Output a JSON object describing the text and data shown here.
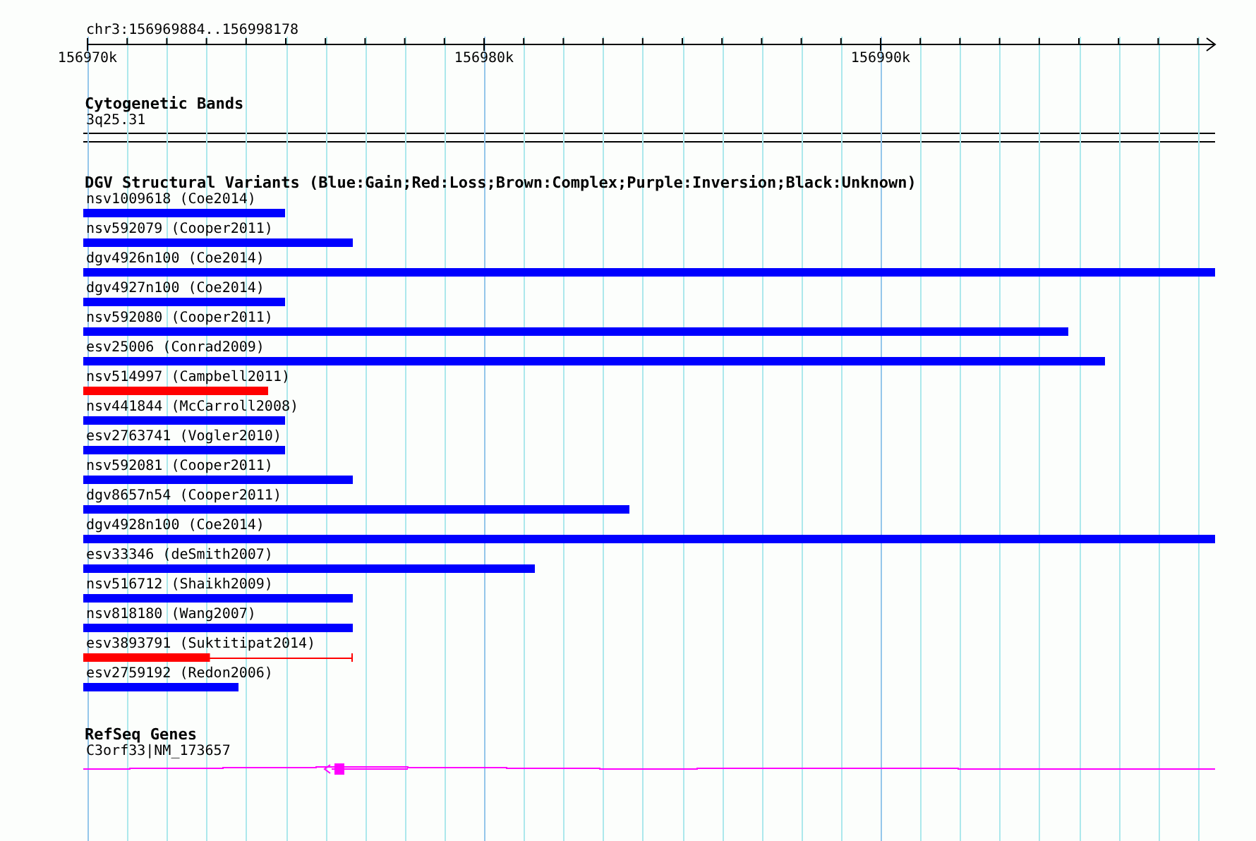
{
  "ruler": {
    "range": "chr3:156969884..156998178",
    "tick_labels": [
      "156970k",
      "156980k",
      "156990k"
    ]
  },
  "cytogenetic_bands": {
    "title": "Cytogenetic Bands",
    "band": "3q25.31"
  },
  "structural_variants": {
    "title": "DGV Structural Variants (Blue:Gain;Red:Loss;Brown:Complex;Purple:Inversion;Black:Unknown)",
    "items": [
      {
        "label": "nsv1009618 (Coe2014)",
        "color": "#0000ff",
        "level": 0.178,
        "kind": "solid"
      },
      {
        "label": "nsv592079 (Cooper2011)",
        "color": "#0000ff",
        "level": 0.238,
        "kind": "solid"
      },
      {
        "label": "dgv4926n100 (Coe2014)",
        "color": "#0000ff",
        "level": 1,
        "kind": "solid"
      },
      {
        "label": "dgv4927n100 (Coe2014)",
        "color": "#0000ff",
        "level": 0.178,
        "kind": "solid"
      },
      {
        "label": "nsv592080 (Cooper2011)",
        "color": "#0000ff",
        "level": 0.87,
        "kind": "solid"
      },
      {
        "label": "esv25006 (Conrad2009)",
        "color": "#0000ff",
        "level": 0.903,
        "kind": "solid"
      },
      {
        "label": "nsv514997 (Campbell2011)",
        "color": "#ff0000",
        "level": 0.163,
        "kind": "solid"
      },
      {
        "label": "nsv441844 (McCarroll2008)",
        "color": "#0000ff",
        "level": 0.178,
        "kind": "solid"
      },
      {
        "label": "esv2763741 (Vogler2010)",
        "color": "#0000ff",
        "level": 0.178,
        "kind": "solid"
      },
      {
        "label": "nsv592081 (Cooper2011)",
        "color": "#0000ff",
        "level": 0.238,
        "kind": "solid"
      },
      {
        "label": "dgv8657n54 (Cooper2011)",
        "color": "#0000ff",
        "level": 0.483,
        "kind": "solid"
      },
      {
        "label": "dgv4928n100 (Coe2014)",
        "color": "#0000ff",
        "level": 1,
        "kind": "solid"
      },
      {
        "label": "esv33346 (deSmith2007)",
        "color": "#0000ff",
        "level": 0.399,
        "kind": "solid"
      },
      {
        "label": "nsv516712 (Shaikh2009)",
        "color": "#0000ff",
        "level": 0.238,
        "kind": "solid"
      },
      {
        "label": "nsv818180 (Wang2007)",
        "color": "#0000ff",
        "level": 0.238,
        "kind": "solid"
      },
      {
        "label": "esv3893791 (Suktitipat2014)",
        "color": "#ff0000",
        "level": 0.238,
        "kind": "partial"
      },
      {
        "label": "esv2759192 (Redon2006)",
        "color": "#0000ff",
        "level": 0.137,
        "kind": "solid"
      }
    ]
  },
  "refseq_genes": {
    "title": "RefSeq Genes",
    "gene": "C3orf33|NM_173657"
  }
}
